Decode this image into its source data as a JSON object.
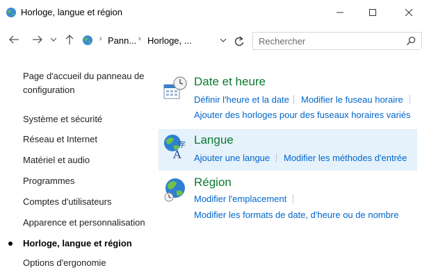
{
  "window": {
    "title": "Horloge, langue et région",
    "controls": {
      "minimize": "—",
      "maximize": "☐",
      "close": "✕"
    }
  },
  "address_bar": {
    "crumbs": [
      "Pann...",
      "Horloge, ..."
    ],
    "separator": "›"
  },
  "search": {
    "placeholder": "Rechercher"
  },
  "left_nav": {
    "items": [
      {
        "label": "Page d'accueil du panneau de configuration"
      },
      {
        "label": "Système et sécurité"
      },
      {
        "label": "Réseau et Internet"
      },
      {
        "label": "Matériel et audio"
      },
      {
        "label": "Programmes"
      },
      {
        "label": "Comptes d'utilisateurs"
      },
      {
        "label": "Apparence et personnalisation"
      },
      {
        "label": "Horloge, langue et région",
        "current": true
      },
      {
        "label": "Options d'ergonomie"
      }
    ]
  },
  "sections": {
    "date": {
      "title": "Date et heure",
      "links": [
        "Définir l'heure et la date",
        "Modifier le fuseau horaire",
        "Ajouter des horloges pour des fuseaux horaires variés"
      ]
    },
    "language": {
      "title": "Langue",
      "links": [
        "Ajouter une langue",
        "Modifier les méthodes d'entrée"
      ]
    },
    "region": {
      "title": "Région",
      "links": [
        "Modifier l'emplacement",
        "Modifier les formats de date, d'heure ou de nombre"
      ]
    }
  },
  "colors": {
    "title_green": "#0a7a2e",
    "link_blue": "#0066cc",
    "hover_bg": "#e5f1fb"
  },
  "icons": {
    "title": "control-panel-globe-icon",
    "date": "clock-calendar-icon",
    "language": "language-globe-icon",
    "region": "region-globe-icon"
  }
}
